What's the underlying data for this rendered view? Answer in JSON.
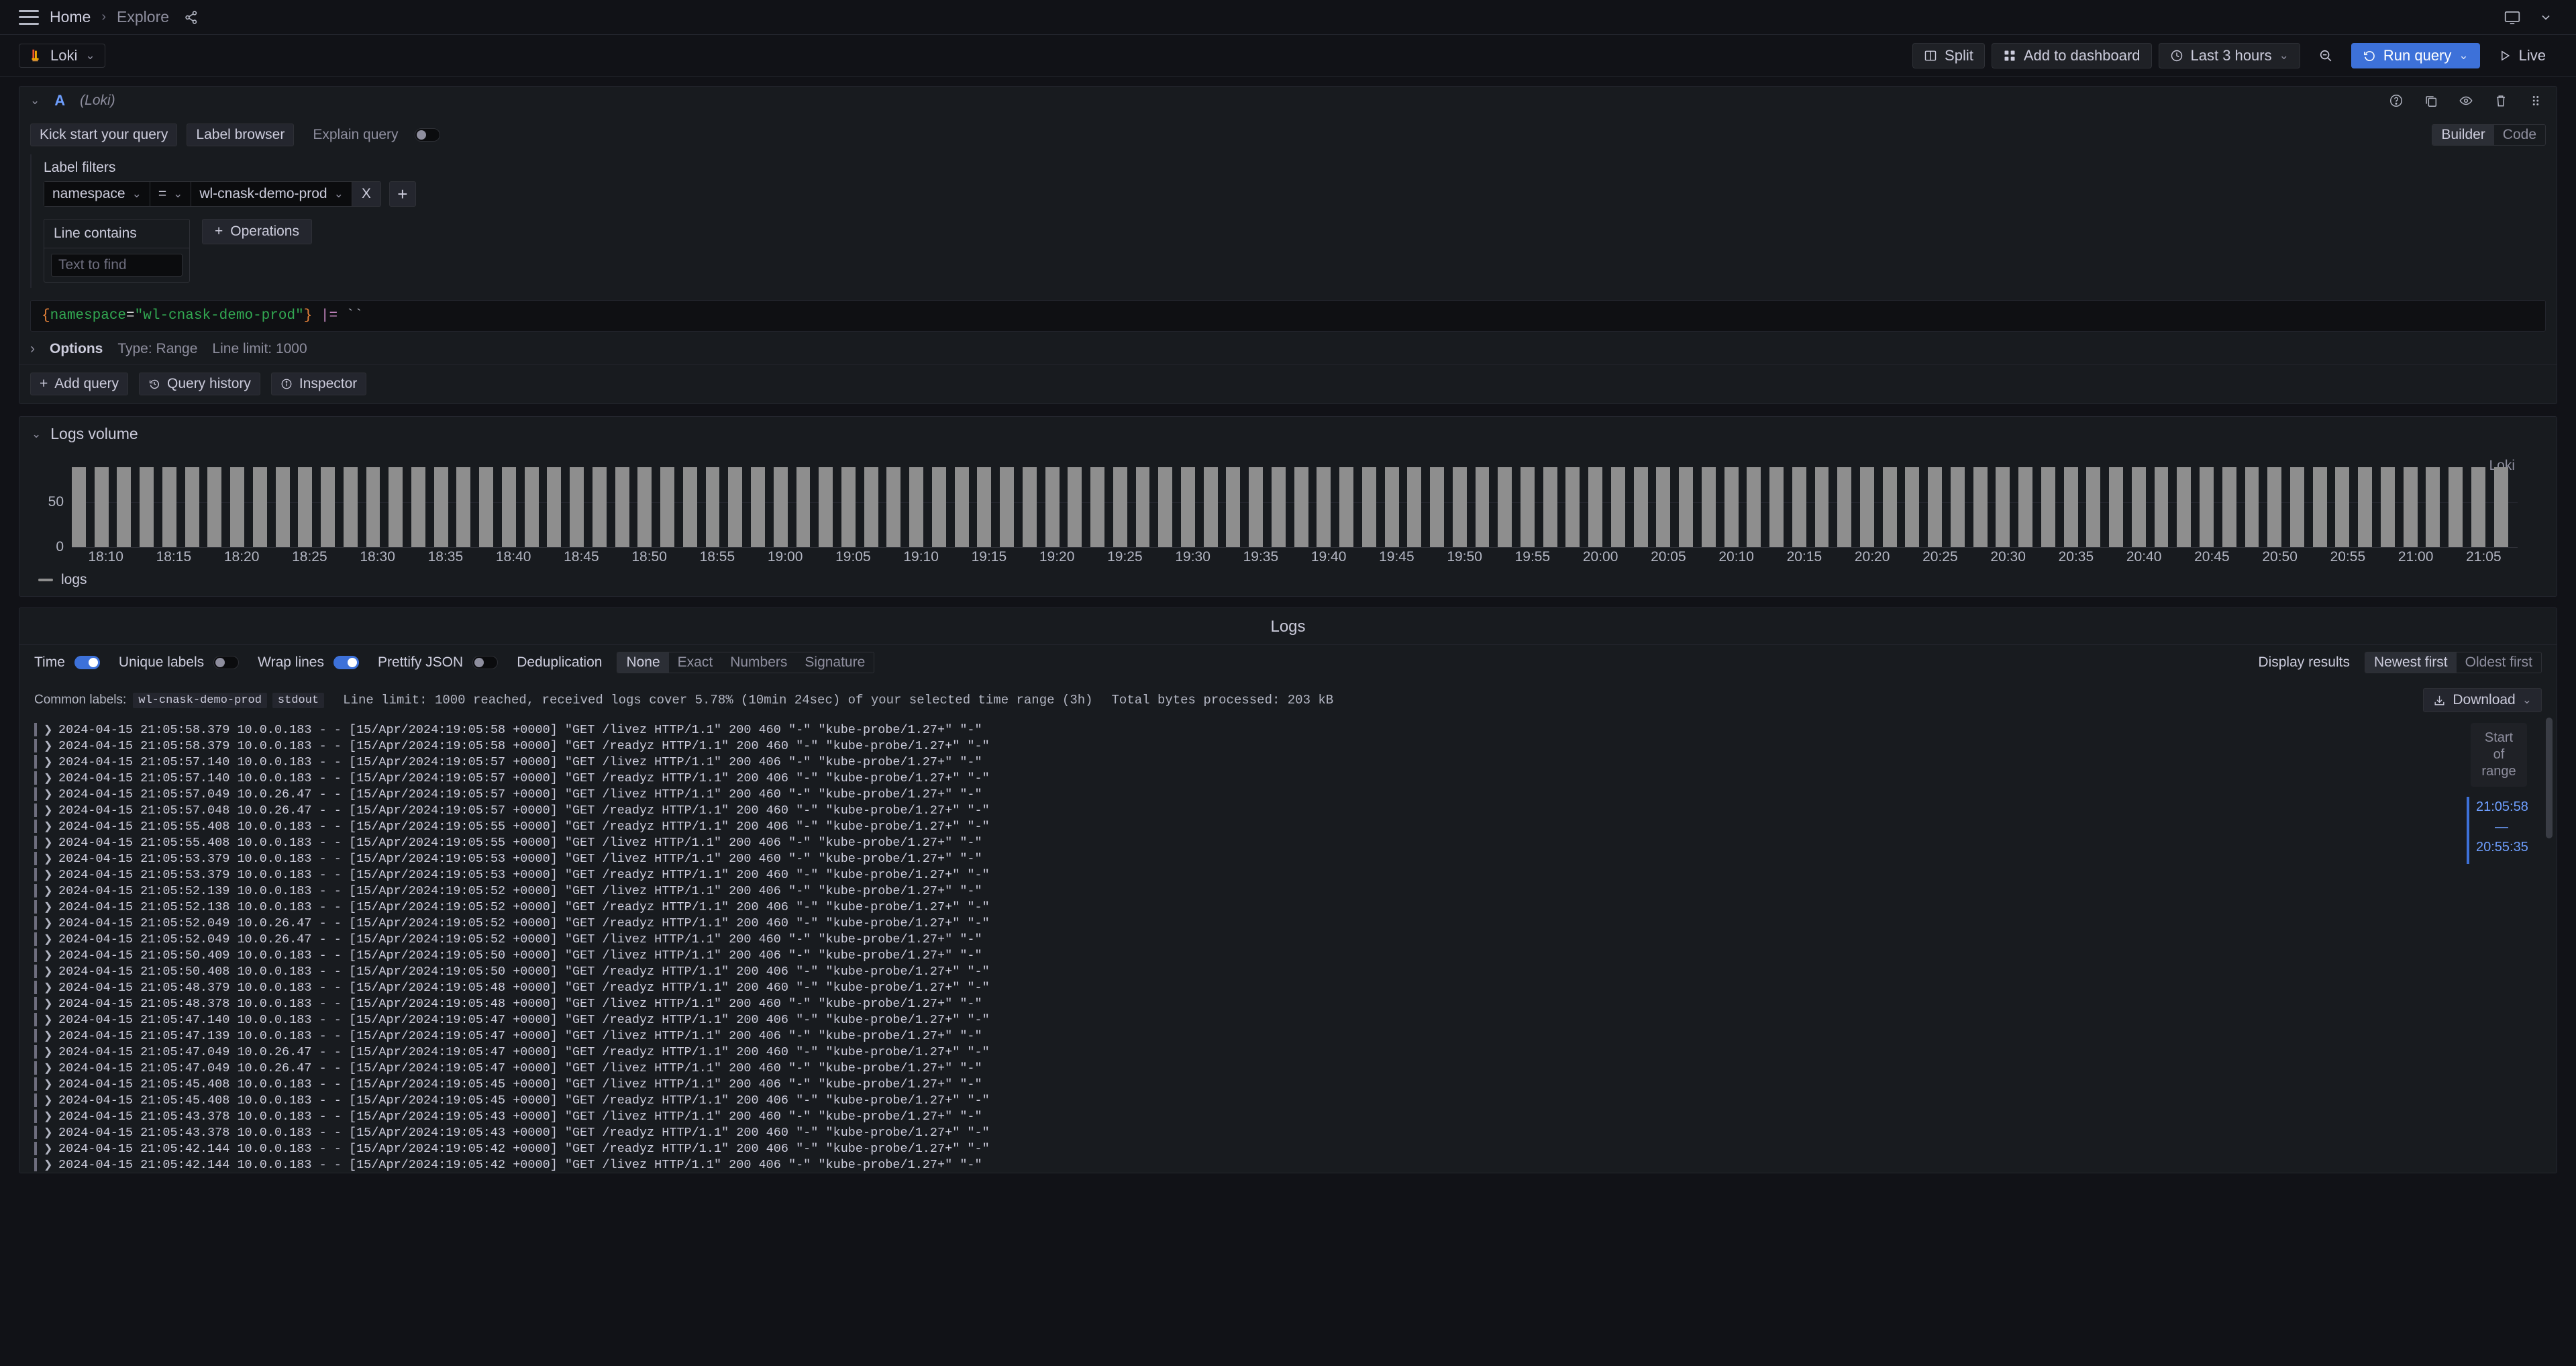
{
  "topnav": {
    "menu_icon": "hamburger-icon",
    "breadcrumb_home": "Home",
    "breadcrumb_sep": "›",
    "breadcrumb_current": "Explore",
    "share_icon": "share-icon",
    "monitor_icon": "monitor-icon",
    "chevron_icon": "chevron-down-icon"
  },
  "toolbar": {
    "datasource": "Loki",
    "split_label": "Split",
    "add_to_dashboard_label": "Add to dashboard",
    "time_range_label": "Last 3 hours",
    "zoom_out_icon": "zoom-out-icon",
    "run_query_label": "Run query",
    "live_label": "Live"
  },
  "query_row": {
    "ref_id": "A",
    "datasource_note": "(Loki)",
    "icons": [
      "help-icon",
      "copy-icon",
      "eye-icon",
      "trash-icon",
      "drag-handle-icon"
    ],
    "kick_start_label": "Kick start your query",
    "label_browser_label": "Label browser",
    "explain_query_label": "Explain query",
    "explain_query_on": false,
    "mode_builder": "Builder",
    "mode_code": "Code",
    "mode_active": "Builder"
  },
  "builder": {
    "label_filters_title": "Label filters",
    "filter": {
      "label": "namespace",
      "operator": "=",
      "value": "wl-cnask-demo-prod",
      "remove_label": "X"
    },
    "add_filter_label": "+",
    "line_contains_title": "Line contains",
    "line_contains_value": "",
    "line_contains_placeholder": "Text to find",
    "operations_label": "Operations"
  },
  "query_preview": {
    "brace_open": "{",
    "label": "namespace",
    "equals": "=",
    "value": "\"wl-cnask-demo-prod\"",
    "brace_close": "}",
    "operator": "|=",
    "backticks": "``"
  },
  "options": {
    "title": "Options",
    "type": "Type: Range",
    "line_limit": "Line limit: 1000",
    "expand_icon": "chevron-right-icon"
  },
  "query_actions": {
    "add_query_label": "Add query",
    "query_history_label": "Query history",
    "inspector_label": "Inspector"
  },
  "logs_volume": {
    "title": "Logs volume",
    "datasource_tag": "Loki",
    "legend_label": "logs"
  },
  "chart_data": {
    "type": "bar",
    "title": "Logs volume",
    "xlabel": "",
    "ylabel": "",
    "ylim": [
      0,
      100
    ],
    "yticks": [
      0,
      50
    ],
    "grid": true,
    "legend": [
      "logs"
    ],
    "legend_position": "bottom-left",
    "series_color": "#8e8e8e",
    "xtick_labels": [
      "18:10",
      "18:15",
      "18:20",
      "18:25",
      "18:30",
      "18:35",
      "18:40",
      "18:45",
      "18:50",
      "18:55",
      "19:00",
      "19:05",
      "19:10",
      "19:15",
      "19:20",
      "19:25",
      "19:30",
      "19:35",
      "19:40",
      "19:45",
      "19:50",
      "19:55",
      "20:00",
      "20:05",
      "20:10",
      "20:15",
      "20:20",
      "20:25",
      "20:30",
      "20:35",
      "20:40",
      "20:45",
      "20:50",
      "20:55",
      "21:00",
      "21:05"
    ],
    "series": [
      {
        "name": "logs",
        "values": [
          88,
          88,
          88,
          88,
          88,
          88,
          88,
          88,
          88,
          88,
          88,
          88,
          88,
          88,
          88,
          88,
          88,
          88,
          88,
          88,
          88,
          88,
          88,
          88,
          88,
          88,
          88,
          88,
          88,
          88,
          88,
          88,
          88,
          88,
          88,
          88,
          88,
          88,
          88,
          88,
          88,
          88,
          88,
          88,
          88,
          88,
          88,
          88,
          88,
          88,
          88,
          88,
          88,
          88,
          88,
          88,
          88,
          88,
          88,
          88,
          88,
          88,
          88,
          88,
          88,
          88,
          88,
          88,
          88,
          88,
          88,
          88,
          88,
          88,
          88,
          88,
          88,
          88,
          88,
          88,
          88,
          88,
          88,
          88,
          88,
          88,
          88,
          88,
          88,
          88,
          88,
          88,
          88,
          88,
          88,
          88,
          88,
          88,
          88,
          88,
          88,
          88,
          88,
          88,
          88,
          88,
          88,
          88
        ]
      }
    ]
  },
  "logs_panel": {
    "title": "Logs",
    "controls": {
      "time_label": "Time",
      "time_on": true,
      "unique_labels_label": "Unique labels",
      "unique_labels_on": false,
      "wrap_lines_label": "Wrap lines",
      "wrap_lines_on": true,
      "prettify_json_label": "Prettify JSON",
      "prettify_json_on": false,
      "deduplication_label": "Deduplication",
      "dedup_options": [
        "None",
        "Exact",
        "Numbers",
        "Signature"
      ],
      "dedup_active": "None",
      "display_results_label": "Display results",
      "order_options": [
        "Newest first",
        "Oldest first"
      ],
      "order_active": "Newest first"
    },
    "meta": {
      "common_labels_label": "Common labels:",
      "common_label_chips": [
        "wl-cnask-demo-prod",
        "stdout"
      ],
      "line_limit_text": "Line limit: 1000 reached, received logs cover 5.78% (10min 24sec) of your selected time range (3h)",
      "total_bytes_text": "Total bytes processed: 203 kB",
      "download_label": "Download"
    },
    "range_indicator": {
      "title_line1": "Start",
      "title_line2": "of",
      "title_line3": "range",
      "time_start": "21:05:58",
      "time_dash": "—",
      "time_end": "20:55:35"
    },
    "log_lines": [
      "2024-04-15 21:05:58.379 10.0.0.183 - - [15/Apr/2024:19:05:58 +0000] \"GET /livez HTTP/1.1\" 200 460 \"-\" \"kube-probe/1.27+\" \"-\"",
      "2024-04-15 21:05:58.379 10.0.0.183 - - [15/Apr/2024:19:05:58 +0000] \"GET /readyz HTTP/1.1\" 200 460 \"-\" \"kube-probe/1.27+\" \"-\"",
      "2024-04-15 21:05:57.140 10.0.0.183 - - [15/Apr/2024:19:05:57 +0000] \"GET /livez HTTP/1.1\" 200 406 \"-\" \"kube-probe/1.27+\" \"-\"",
      "2024-04-15 21:05:57.140 10.0.0.183 - - [15/Apr/2024:19:05:57 +0000] \"GET /readyz HTTP/1.1\" 200 406 \"-\" \"kube-probe/1.27+\" \"-\"",
      "2024-04-15 21:05:57.049 10.0.26.47 - - [15/Apr/2024:19:05:57 +0000] \"GET /livez HTTP/1.1\" 200 460 \"-\" \"kube-probe/1.27+\" \"-\"",
      "2024-04-15 21:05:57.048 10.0.26.47 - - [15/Apr/2024:19:05:57 +0000] \"GET /readyz HTTP/1.1\" 200 460 \"-\" \"kube-probe/1.27+\" \"-\"",
      "2024-04-15 21:05:55.408 10.0.0.183 - - [15/Apr/2024:19:05:55 +0000] \"GET /readyz HTTP/1.1\" 200 406 \"-\" \"kube-probe/1.27+\" \"-\"",
      "2024-04-15 21:05:55.408 10.0.0.183 - - [15/Apr/2024:19:05:55 +0000] \"GET /livez HTTP/1.1\" 200 406 \"-\" \"kube-probe/1.27+\" \"-\"",
      "2024-04-15 21:05:53.379 10.0.0.183 - - [15/Apr/2024:19:05:53 +0000] \"GET /livez HTTP/1.1\" 200 460 \"-\" \"kube-probe/1.27+\" \"-\"",
      "2024-04-15 21:05:53.379 10.0.0.183 - - [15/Apr/2024:19:05:53 +0000] \"GET /readyz HTTP/1.1\" 200 460 \"-\" \"kube-probe/1.27+\" \"-\"",
      "2024-04-15 21:05:52.139 10.0.0.183 - - [15/Apr/2024:19:05:52 +0000] \"GET /livez HTTP/1.1\" 200 406 \"-\" \"kube-probe/1.27+\" \"-\"",
      "2024-04-15 21:05:52.138 10.0.0.183 - - [15/Apr/2024:19:05:52 +0000] \"GET /readyz HTTP/1.1\" 200 406 \"-\" \"kube-probe/1.27+\" \"-\"",
      "2024-04-15 21:05:52.049 10.0.26.47 - - [15/Apr/2024:19:05:52 +0000] \"GET /readyz HTTP/1.1\" 200 460 \"-\" \"kube-probe/1.27+\" \"-\"",
      "2024-04-15 21:05:52.049 10.0.26.47 - - [15/Apr/2024:19:05:52 +0000] \"GET /livez HTTP/1.1\" 200 460 \"-\" \"kube-probe/1.27+\" \"-\"",
      "2024-04-15 21:05:50.409 10.0.0.183 - - [15/Apr/2024:19:05:50 +0000] \"GET /livez HTTP/1.1\" 200 406 \"-\" \"kube-probe/1.27+\" \"-\"",
      "2024-04-15 21:05:50.408 10.0.0.183 - - [15/Apr/2024:19:05:50 +0000] \"GET /readyz HTTP/1.1\" 200 406 \"-\" \"kube-probe/1.27+\" \"-\"",
      "2024-04-15 21:05:48.379 10.0.0.183 - - [15/Apr/2024:19:05:48 +0000] \"GET /readyz HTTP/1.1\" 200 460 \"-\" \"kube-probe/1.27+\" \"-\"",
      "2024-04-15 21:05:48.378 10.0.0.183 - - [15/Apr/2024:19:05:48 +0000] \"GET /livez HTTP/1.1\" 200 460 \"-\" \"kube-probe/1.27+\" \"-\"",
      "2024-04-15 21:05:47.140 10.0.0.183 - - [15/Apr/2024:19:05:47 +0000] \"GET /readyz HTTP/1.1\" 200 406 \"-\" \"kube-probe/1.27+\" \"-\"",
      "2024-04-15 21:05:47.139 10.0.0.183 - - [15/Apr/2024:19:05:47 +0000] \"GET /livez HTTP/1.1\" 200 406 \"-\" \"kube-probe/1.27+\" \"-\"",
      "2024-04-15 21:05:47.049 10.0.26.47 - - [15/Apr/2024:19:05:47 +0000] \"GET /readyz HTTP/1.1\" 200 460 \"-\" \"kube-probe/1.27+\" \"-\"",
      "2024-04-15 21:05:47.049 10.0.26.47 - - [15/Apr/2024:19:05:47 +0000] \"GET /livez HTTP/1.1\" 200 460 \"-\" \"kube-probe/1.27+\" \"-\"",
      "2024-04-15 21:05:45.408 10.0.0.183 - - [15/Apr/2024:19:05:45 +0000] \"GET /livez HTTP/1.1\" 200 406 \"-\" \"kube-probe/1.27+\" \"-\"",
      "2024-04-15 21:05:45.408 10.0.0.183 - - [15/Apr/2024:19:05:45 +0000] \"GET /readyz HTTP/1.1\" 200 406 \"-\" \"kube-probe/1.27+\" \"-\"",
      "2024-04-15 21:05:43.378 10.0.0.183 - - [15/Apr/2024:19:05:43 +0000] \"GET /livez HTTP/1.1\" 200 460 \"-\" \"kube-probe/1.27+\" \"-\"",
      "2024-04-15 21:05:43.378 10.0.0.183 - - [15/Apr/2024:19:05:43 +0000] \"GET /readyz HTTP/1.1\" 200 460 \"-\" \"kube-probe/1.27+\" \"-\"",
      "2024-04-15 21:05:42.144 10.0.0.183 - - [15/Apr/2024:19:05:42 +0000] \"GET /readyz HTTP/1.1\" 200 406 \"-\" \"kube-probe/1.27+\" \"-\"",
      "2024-04-15 21:05:42.144 10.0.0.183 - - [15/Apr/2024:19:05:42 +0000] \"GET /livez HTTP/1.1\" 200 406 \"-\" \"kube-probe/1.27+\" \"-\""
    ]
  }
}
